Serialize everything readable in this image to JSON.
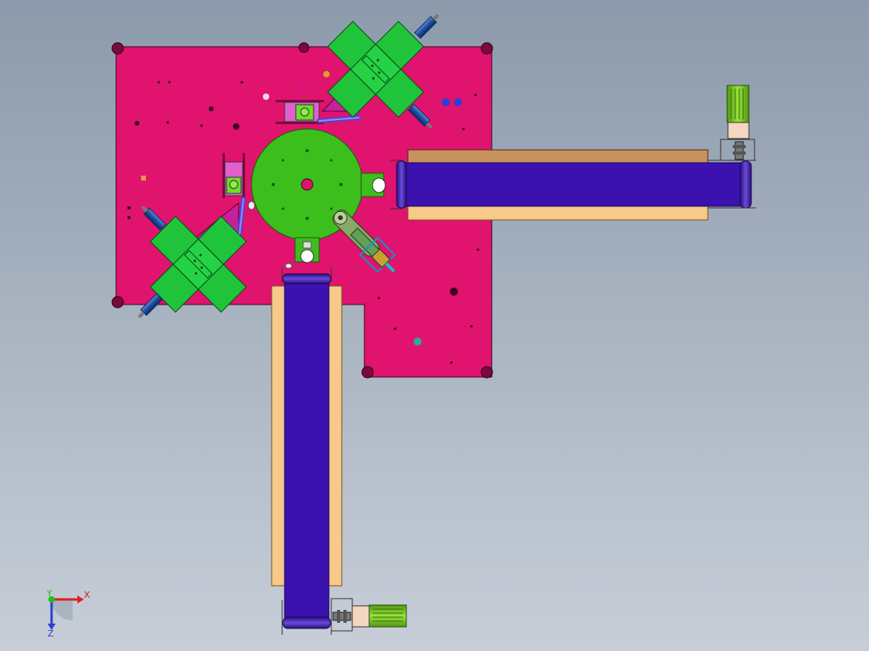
{
  "viewport": {
    "background_top": "#8c9aab",
    "background_bottom": "#c7ced8"
  },
  "colors": {
    "base_plate": "#e0136e",
    "turntable": "#3cbf1c",
    "station_block": "#1fc43a",
    "conveyor_belt": "#3b12b0",
    "conveyor_side_light": "#f7c98a",
    "conveyor_side_tan": "#c8925e",
    "motor_body": "#7dd11e",
    "cylinder_rod": "#1c4fa0",
    "bracket_magenta": "#c8209a",
    "outline": "#1a1a1a"
  },
  "triad": {
    "x_label": "X",
    "y_label": "Y",
    "z_label": "Z",
    "x_color": "#e01f1f",
    "y_color": "#22c01f",
    "z_color": "#2a3fd6"
  }
}
